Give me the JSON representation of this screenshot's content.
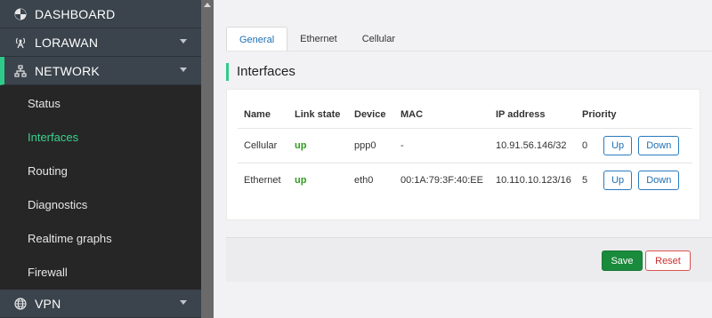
{
  "sidebar": {
    "dashboard": "DASHBOARD",
    "lorawan": "LORAWAN",
    "network": "NETWORK",
    "items": [
      {
        "label": "Status"
      },
      {
        "label": "Interfaces"
      },
      {
        "label": "Routing"
      },
      {
        "label": "Diagnostics"
      },
      {
        "label": "Realtime graphs"
      },
      {
        "label": "Firewall"
      }
    ],
    "vpn": "VPN",
    "active_accent": "#2ecc8a"
  },
  "tabs": [
    {
      "label": "General"
    },
    {
      "label": "Ethernet"
    },
    {
      "label": "Cellular"
    }
  ],
  "section_title": "Interfaces",
  "table": {
    "headers": {
      "name": "Name",
      "link": "Link state",
      "device": "Device",
      "mac": "MAC",
      "ip": "IP address",
      "priority": "Priority"
    },
    "rows": [
      {
        "name": "Cellular",
        "link": "up",
        "device": "ppp0",
        "mac": "-",
        "ip": "10.91.56.146/32",
        "priority": "0",
        "up_label": "Up",
        "down_label": "Down"
      },
      {
        "name": "Ethernet",
        "link": "up",
        "device": "eth0",
        "mac": "00:1A:79:3F:40:EE",
        "ip": "10.110.10.123/16",
        "priority": "5",
        "up_label": "Up",
        "down_label": "Down"
      }
    ]
  },
  "footer": {
    "save_label": "Save",
    "reset_label": "Reset"
  }
}
